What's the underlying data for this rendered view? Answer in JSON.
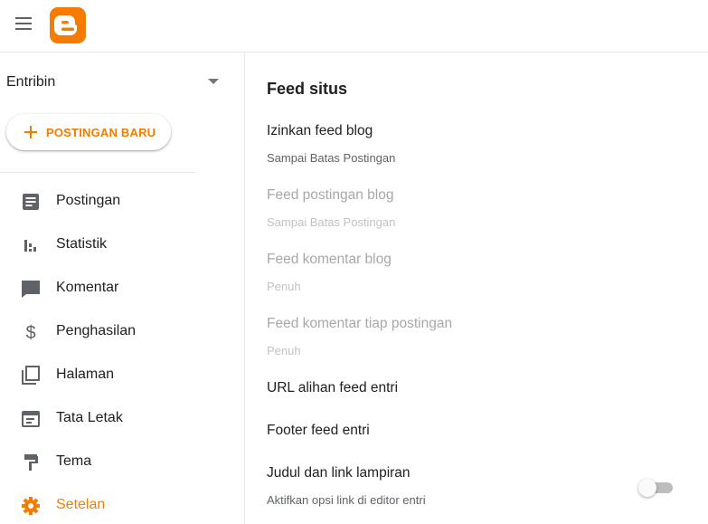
{
  "app": {
    "logo_icon": "blogger-logo",
    "brand_color": "#f57c00"
  },
  "sidebar": {
    "blog_name": "Entribin",
    "new_post_label": "POSTINGAN BARU",
    "items": [
      {
        "label": "Postingan",
        "icon": "posts-icon",
        "active": false
      },
      {
        "label": "Statistik",
        "icon": "stats-icon",
        "active": false
      },
      {
        "label": "Komentar",
        "icon": "comment-icon",
        "active": false
      },
      {
        "label": "Penghasilan",
        "icon": "dollar-icon",
        "active": false
      },
      {
        "label": "Halaman",
        "icon": "pages-icon",
        "active": false
      },
      {
        "label": "Tata Letak",
        "icon": "layout-icon",
        "active": false
      },
      {
        "label": "Tema",
        "icon": "theme-icon",
        "active": false
      },
      {
        "label": "Setelan",
        "icon": "gear-icon",
        "active": true
      }
    ]
  },
  "main": {
    "section_title": "Feed situs",
    "settings": [
      {
        "title": "Izinkan feed blog",
        "subtitle": "Sampai Batas Postingan",
        "enabled": true
      },
      {
        "title": "Feed postingan blog",
        "subtitle": "Sampai Batas Postingan",
        "enabled": false
      },
      {
        "title": "Feed komentar blog",
        "subtitle": "Penuh",
        "enabled": false
      },
      {
        "title": "Feed komentar tiap postingan",
        "subtitle": "Penuh",
        "enabled": false
      },
      {
        "title": "URL alihan feed entri",
        "subtitle": "",
        "enabled": true
      },
      {
        "title": "Footer feed entri",
        "subtitle": "",
        "enabled": true
      },
      {
        "title": "Judul dan link lampiran",
        "subtitle": "Aktifkan opsi link di editor entri",
        "enabled": true,
        "toggle_on": false
      }
    ]
  }
}
